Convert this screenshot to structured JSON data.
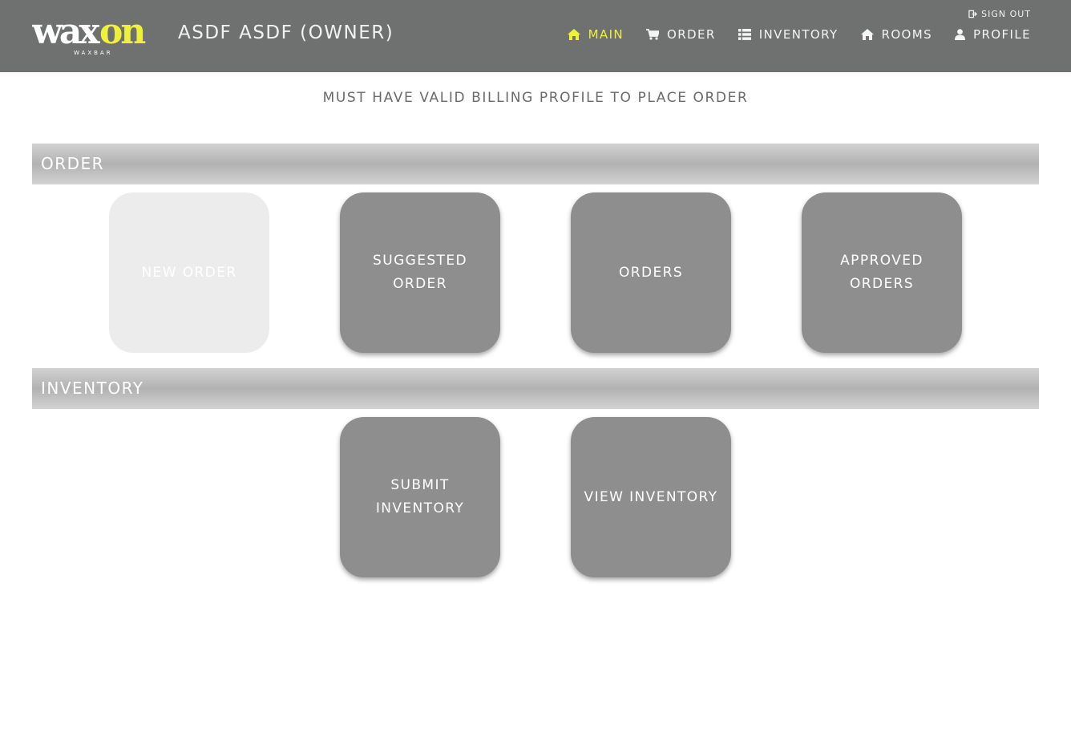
{
  "header": {
    "logo_text": "waxon",
    "logo_subtext": "WAXBAR",
    "user_title": "ASDF ASDF (OWNER)",
    "sign_out": "SIGN OUT",
    "nav": [
      {
        "label": "MAIN",
        "icon": "home-icon",
        "active": true
      },
      {
        "label": "ORDER",
        "icon": "cart-icon",
        "active": false
      },
      {
        "label": "INVENTORY",
        "icon": "list-icon",
        "active": false
      },
      {
        "label": "ROOMS",
        "icon": "home-icon",
        "active": false
      },
      {
        "label": "PROFILE",
        "icon": "user-icon",
        "active": false
      }
    ],
    "colors": {
      "bar": "#6f7170",
      "accent": "#eef03a"
    }
  },
  "notice": "MUST HAVE VALID BILLING PROFILE TO PLACE ORDER",
  "sections": {
    "order": {
      "title": "ORDER",
      "tiles": [
        {
          "label": "NEW ORDER",
          "disabled": true
        },
        {
          "label": "SUGGESTED ORDER",
          "disabled": false
        },
        {
          "label": "ORDERS",
          "disabled": false
        },
        {
          "label": "APPROVED ORDERS",
          "disabled": false
        }
      ]
    },
    "inventory": {
      "title": "INVENTORY",
      "tiles": [
        {
          "label": "SUBMIT INVENTORY",
          "disabled": false
        },
        {
          "label": "VIEW INVENTORY",
          "disabled": false
        }
      ]
    }
  }
}
